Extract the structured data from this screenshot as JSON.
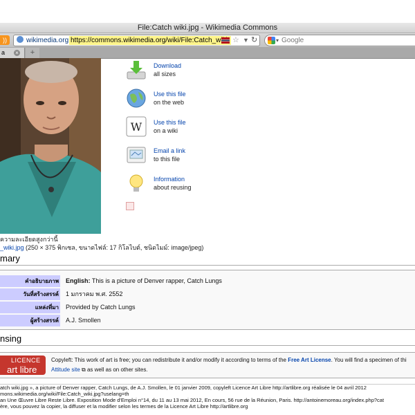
{
  "window": {
    "title": "File:Catch wiki.jpg - Wikimedia Commons"
  },
  "toolbar": {
    "site_label": "wikimedia.org",
    "url": "https://commons.wikimedia.org/wiki/File:Catch_wiki.",
    "search_placeholder": "Google"
  },
  "tabs": {
    "first_label": "a",
    "new_tab": "+"
  },
  "side_actions": [
    {
      "label": "Download",
      "sub": "all sizes",
      "icon": "download-icon"
    },
    {
      "label": "Use this file",
      "sub": "on the web",
      "icon": "globe-icon"
    },
    {
      "label": "Use this file",
      "sub": "on a wiki",
      "icon": "wikipedia-icon"
    },
    {
      "label": "Email a link",
      "sub": "to this file",
      "icon": "email-icon"
    },
    {
      "label": "Information",
      "sub": "about reusing",
      "icon": "lightbulb-icon"
    }
  ],
  "captions": {
    "higher_res": "ความละเอียดสูงกว่านี้",
    "file_link": "_wiki.jpg",
    "file_info": " (250 × 375 พิกเซล, ขนาดไฟล์: 17 กิโลไบต์, ชนิดไมม์: image/jpeg)"
  },
  "summary": {
    "heading": "mary",
    "rows": [
      {
        "label": "คำอธิบายภาพ",
        "value_bold": "English:",
        "value": " This is a picture of Denver rapper, Catch Lungs"
      },
      {
        "label": "วันที่สร้างสรรค์",
        "value_bold": "",
        "value": "1 มกราคม พ.ศ. 2552"
      },
      {
        "label": "แหล่งที่มา",
        "value_bold": "",
        "value": "Provided by Catch Lungs"
      },
      {
        "label": "ผู้สร้างสรรค์",
        "value_bold": "",
        "value": "A.J. Smollen"
      }
    ]
  },
  "licensing": {
    "heading": "nsing",
    "badge_top": "LICENCE",
    "badge_bottom": "art libre",
    "text_pre": "Copyleft: This work of art is free; you can redistribute it and/or modify it according to terms of the ",
    "link": "Free Art License",
    "text_post": ". You will find a specimen of thi",
    "line2_link": "Attitude site",
    "line2_post": " as well as on other sites."
  },
  "footer": {
    "line1": "atch wiki.jpg », a picture of Denver rapper, Catch Lungs, de A.J. Smollen, le 01 janvier 2009, copyleft Licence Art Libre http://artlibre.org réalisée le 04 avril 2012",
    "line2": "mons.wikimedia.org/wiki/File:Catch_wiki.jpg?uselang=th",
    "line3": "an Une Œuvre Libre Reste Libre. Exposition Mode d'Emploi n°14, du 11 au 13 mai 2012, En cours, 56 rue de la Réunion, Paris. http://antoinemoreau.org/index.php?cat",
    "line4": "ère, vous pouvez la copier, la diffuser et la modifier selon les termes de la Licence Art Libre http://artlibre.org"
  }
}
